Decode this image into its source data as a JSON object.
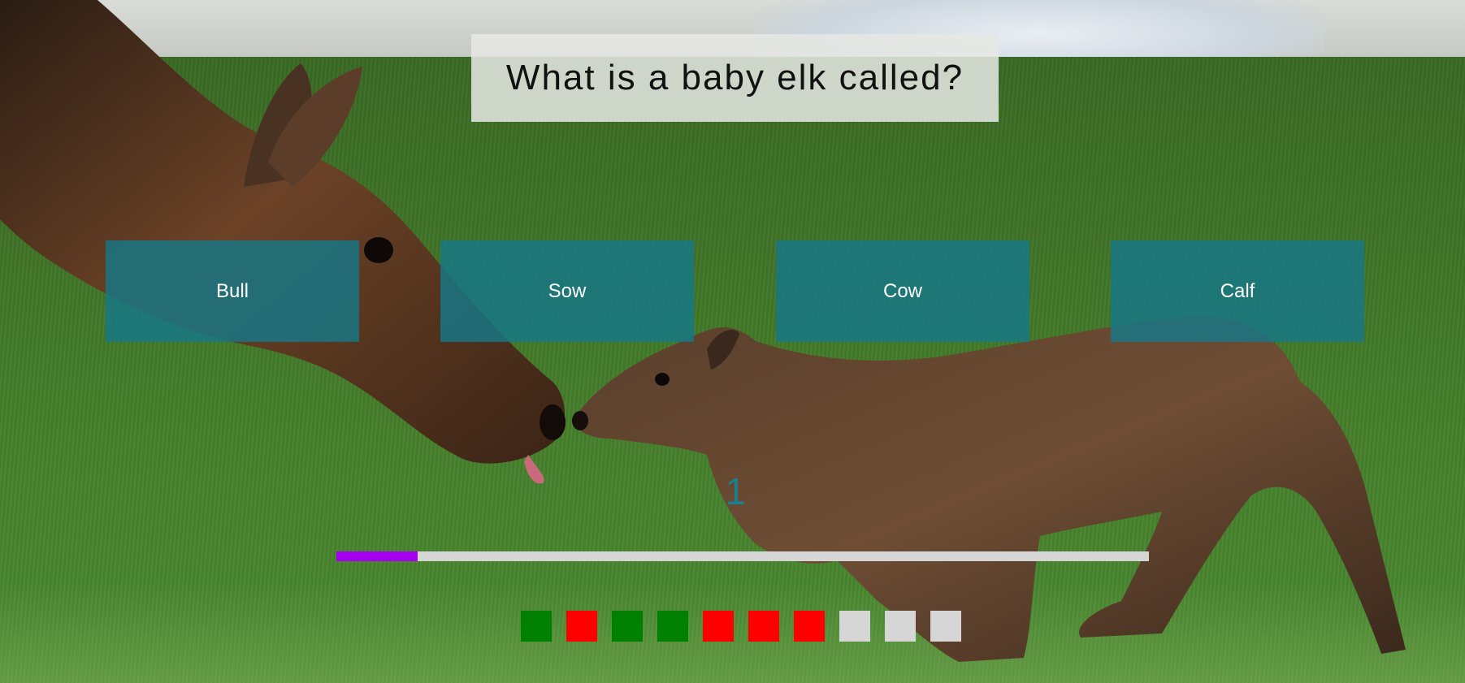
{
  "question": {
    "text": "What is a baby elk called?"
  },
  "answers": [
    {
      "label": "Bull"
    },
    {
      "label": "Sow"
    },
    {
      "label": "Cow"
    },
    {
      "label": "Calf"
    }
  ],
  "timer": {
    "value": "1",
    "progress_fraction": 0.1,
    "progress_color": "#a600f0"
  },
  "score_track": {
    "results": [
      "correct",
      "wrong",
      "correct",
      "correct",
      "wrong",
      "wrong",
      "wrong",
      "pending",
      "pending",
      "pending"
    ],
    "colors": {
      "correct": "#008000",
      "wrong": "#ff0000",
      "pending": "#d6d6d6"
    }
  },
  "theme": {
    "answer_color": "#167887",
    "timer_text_color": "#1a7e8c"
  }
}
